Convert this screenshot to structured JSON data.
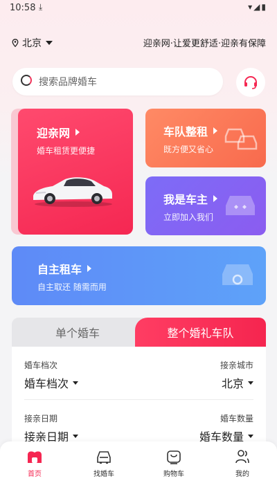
{
  "status_bar": {
    "time": "10:58"
  },
  "header": {
    "city": "北京",
    "slogan": "迎亲网·让爱更舒适·迎亲有保障"
  },
  "search": {
    "placeholder": "搜索品牌婚车"
  },
  "cards": {
    "main": {
      "title": "迎亲网",
      "subtitle": "婚车租赁更便捷"
    },
    "fleet": {
      "title": "车队整租",
      "subtitle": "既方便又省心"
    },
    "owner": {
      "title": "我是车主",
      "subtitle": "立即加入我们"
    },
    "self_rent": {
      "title": "自主租车",
      "subtitle": "自主取还 随需而用"
    }
  },
  "tabs": {
    "single": "单个婚车",
    "fleet": "整个婚礼车队"
  },
  "form": {
    "grade_label": "婚车档次",
    "grade_value": "婚车档次",
    "city_label": "接亲城市",
    "city_value": "北京",
    "date_label": "接亲日期",
    "date_value": "接亲日期",
    "count_label": "婚车数量",
    "count_value": "婚车数量"
  },
  "nav": [
    {
      "label": "首页",
      "icon": "home-icon"
    },
    {
      "label": "找婚车",
      "icon": "car-icon"
    },
    {
      "label": "购物车",
      "icon": "cart-icon"
    },
    {
      "label": "我的",
      "icon": "profile-icon"
    }
  ],
  "colors": {
    "accent": "#f52752",
    "fleet": "#f86a4d",
    "owner": "#8b5cf0",
    "self_rent": "#5e8af7"
  }
}
